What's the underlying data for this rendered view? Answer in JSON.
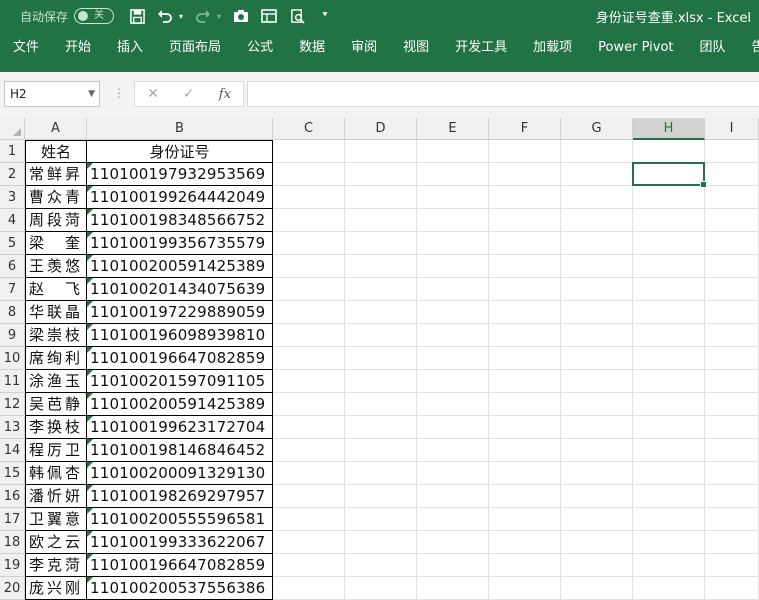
{
  "titlebar": {
    "autosave_label": "自动保存",
    "autosave_state": "关",
    "window_title": "身份证号查重.xlsx  -  Excel"
  },
  "ribbon": {
    "tabs": [
      "文件",
      "开始",
      "插入",
      "页面布局",
      "公式",
      "数据",
      "审阅",
      "视图",
      "开发工具",
      "加载项",
      "Power Pivot",
      "团队",
      "告"
    ]
  },
  "formula_bar": {
    "name_box": "H2",
    "fx": "fx",
    "value": ""
  },
  "columns": [
    "A",
    "B",
    "C",
    "D",
    "E",
    "F",
    "G",
    "H",
    "I"
  ],
  "selected_column": "H",
  "rows": [
    {
      "num": "1",
      "name": "姓名",
      "id": "身份证号"
    },
    {
      "num": "2",
      "name": "常鲜昇",
      "id": "110100197932953569"
    },
    {
      "num": "3",
      "name": "曹众青",
      "id": "110100199264442049"
    },
    {
      "num": "4",
      "name": "周段菏",
      "id": "110100198348566752"
    },
    {
      "num": "5",
      "name": "梁　奎",
      "id": "110100199356735579"
    },
    {
      "num": "6",
      "name": "王羡悠",
      "id": "110100200591425389"
    },
    {
      "num": "7",
      "name": "赵　飞",
      "id": "110100201434075639"
    },
    {
      "num": "8",
      "name": "华联晶",
      "id": "110100197229889059"
    },
    {
      "num": "9",
      "name": "梁崇枝",
      "id": "110100196098939810"
    },
    {
      "num": "10",
      "name": "席绚利",
      "id": "110100196647082859"
    },
    {
      "num": "11",
      "name": "涂渔玉",
      "id": "110100201597091105"
    },
    {
      "num": "12",
      "name": "吴芭静",
      "id": "110100200591425389"
    },
    {
      "num": "13",
      "name": "李换枝",
      "id": "110100199623172704"
    },
    {
      "num": "14",
      "name": "程厉卫",
      "id": "110100198146846452"
    },
    {
      "num": "15",
      "name": "韩佩杏",
      "id": "110100200091329130"
    },
    {
      "num": "16",
      "name": "潘忻妍",
      "id": "110100198269297957"
    },
    {
      "num": "17",
      "name": "卫翼意",
      "id": "110100200555596581"
    },
    {
      "num": "18",
      "name": "欧之云",
      "id": "110100199333622067"
    },
    {
      "num": "19",
      "name": "李克菏",
      "id": "110100196647082859"
    },
    {
      "num": "20",
      "name": "庞兴刚",
      "id": "110100200537556386"
    }
  ]
}
